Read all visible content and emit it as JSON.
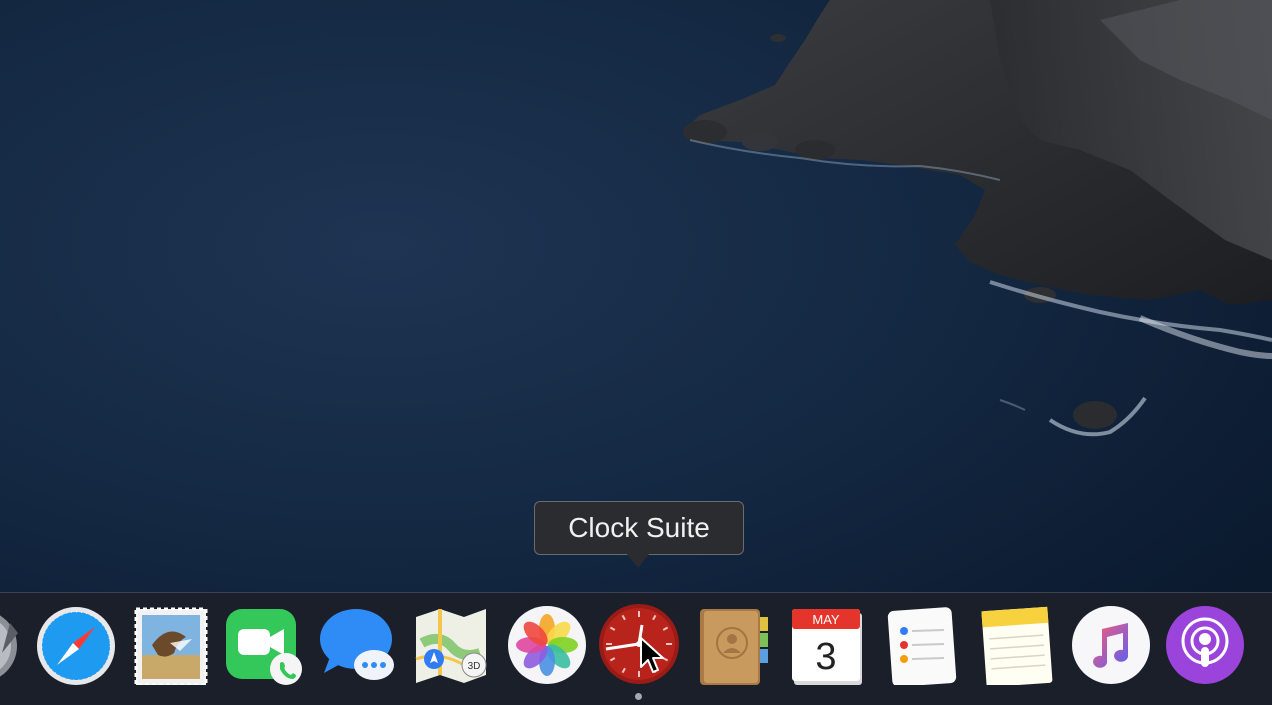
{
  "tooltip": {
    "text": "Clock Suite"
  },
  "dock": {
    "active_app": "Clock Suite",
    "items": [
      {
        "name": "Launchpad",
        "icon": "launchpad-icon"
      },
      {
        "name": "Safari",
        "icon": "safari-compass-icon"
      },
      {
        "name": "Mail",
        "icon": "mail-stamp-icon"
      },
      {
        "name": "FaceTime",
        "icon": "facetime-camera-icon"
      },
      {
        "name": "Messages",
        "icon": "messages-bubble-icon"
      },
      {
        "name": "Maps",
        "icon": "maps-icon"
      },
      {
        "name": "Photos",
        "icon": "photos-flower-icon"
      },
      {
        "name": "Clock Suite",
        "icon": "clock-icon",
        "running": true
      },
      {
        "name": "Contacts",
        "icon": "contacts-book-icon"
      },
      {
        "name": "Calendar",
        "icon": "calendar-icon",
        "month": "MAY",
        "day": "3"
      },
      {
        "name": "Reminders",
        "icon": "reminders-list-icon"
      },
      {
        "name": "Notes",
        "icon": "notes-pad-icon"
      },
      {
        "name": "Music",
        "icon": "music-note-icon"
      },
      {
        "name": "Podcasts",
        "icon": "podcasts-icon"
      }
    ]
  },
  "colors": {
    "dock_background": "#1b1f29",
    "tooltip_background": "#2b2c30",
    "ocean": "#142842"
  }
}
